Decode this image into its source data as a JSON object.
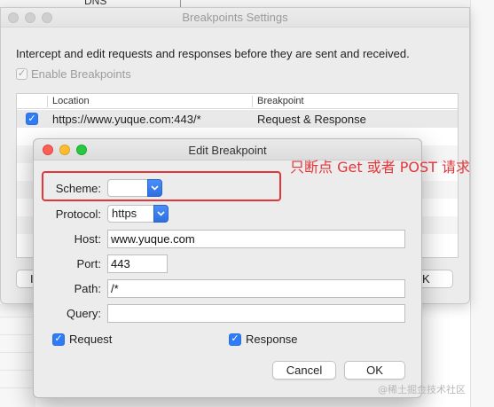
{
  "background": {
    "dns_label": "DNS"
  },
  "breakpoints_window": {
    "title": "Breakpoints Settings",
    "description": "Intercept and edit requests and responses before they are sent and received.",
    "enable_label": "Enable Breakpoints",
    "table": {
      "headers": [
        "Location",
        "Breakpoint"
      ],
      "rows": [
        {
          "checked": true,
          "location": "https://www.yuque.com:443/*",
          "breakpoint": "Request & Response"
        }
      ]
    },
    "left_button_label": "I",
    "right_button_label": "K"
  },
  "edit_dialog": {
    "title": "Edit Breakpoint",
    "scheme": {
      "label": "Scheme:",
      "value": ""
    },
    "protocol": {
      "label": "Protocol:",
      "value": "https"
    },
    "host": {
      "label": "Host:",
      "value": "www.yuque.com"
    },
    "port": {
      "label": "Port:",
      "value": "443"
    },
    "path": {
      "label": "Path:",
      "value": "/*"
    },
    "query": {
      "label": "Query:",
      "value": ""
    },
    "request": {
      "label": "Request",
      "checked": true
    },
    "response": {
      "label": "Response",
      "checked": true
    },
    "cancel_label": "Cancel",
    "ok_label": "OK"
  },
  "annotation": {
    "text": "只断点 Get 或者 POST 请求",
    "color": "#e2363a"
  },
  "watermark": "@稀土掘金技术社区",
  "colors": {
    "accent": "#2f7cf6",
    "window_bg": "#ececec"
  }
}
